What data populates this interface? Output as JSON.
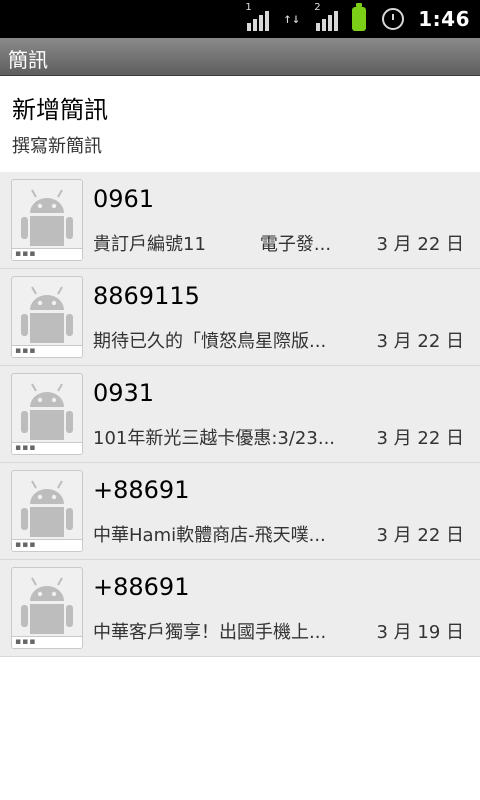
{
  "status_bar": {
    "sim1_label": "1",
    "sim2_label": "2",
    "data_arrows": "↑↓",
    "time": "1:46",
    "icons": [
      "signal-icon",
      "data-icon",
      "signal-icon",
      "battery-icon",
      "alarm-icon"
    ],
    "battery_color": "#7bcf17"
  },
  "title_bar": {
    "title": "簡訊"
  },
  "new_message": {
    "title": "新增簡訊",
    "subtitle": "撰寫新簡訊"
  },
  "conversations": [
    {
      "sender": "0961",
      "snippet": "貴訂戶編號11　　　電子發...",
      "date": "3 月 22 日"
    },
    {
      "sender": "8869115",
      "snippet": "期待已久的「憤怒鳥星際版...",
      "date": "3 月 22 日"
    },
    {
      "sender": "0931",
      "snippet": "101年新光三越卡優惠:3/23...",
      "date": "3 月 22 日"
    },
    {
      "sender": "+88691",
      "snippet": "中華Hami軟體商店-飛天噗...",
      "date": "3 月 22 日"
    },
    {
      "sender": "+88691",
      "snippet": "中華客戶獨享！出國手機上...",
      "date": "3 月 19 日"
    }
  ],
  "avatar_dots": "▪▪▪"
}
